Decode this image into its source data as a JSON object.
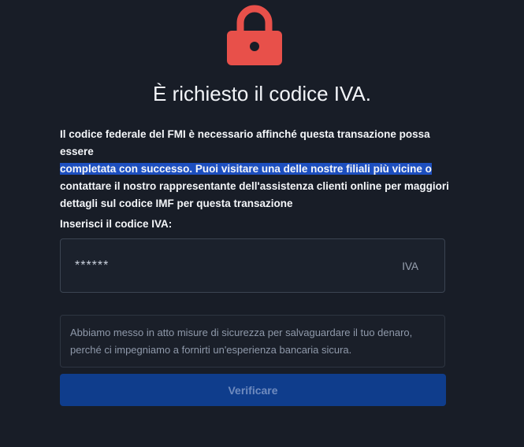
{
  "header": {
    "icon": "lock-icon",
    "title": "È richiesto il codice IVA."
  },
  "description": {
    "line1": "Il codice federale del FMI è necessario affinché questa transazione possa essere",
    "line2": "completata con successo. Puoi visitare una delle nostre filiali più vicine o",
    "line3": "contattare il nostro rappresentante dell'assistenza clienti online per maggiori",
    "line4": "dettagli sul codice IMF per questa transazione"
  },
  "form": {
    "label": "Inserisci il codice IVA:",
    "value": "******",
    "suffix": "IVA"
  },
  "notice": {
    "line1": "Abbiamo messo in atto misure di sicurezza per salvaguardare il tuo denaro,",
    "line2": "perché ci impegniamo a fornirti un'esperienza bancaria sicura."
  },
  "actions": {
    "verify_label": "Verificare"
  },
  "colors": {
    "background": "#181d27",
    "lock": "#e8504a",
    "highlight": "#1d4fbf",
    "button": "#0f3d8c"
  }
}
